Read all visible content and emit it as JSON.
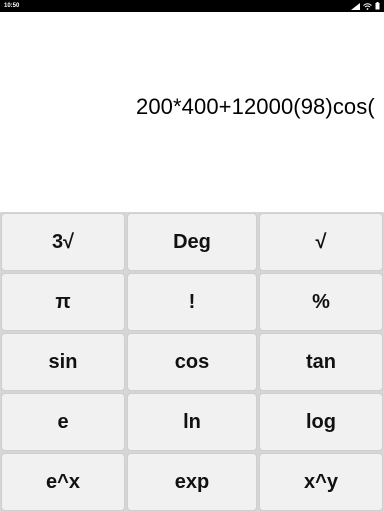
{
  "status_bar": {
    "time": "10:50",
    "icons": [
      "signal-icon",
      "wifi-icon",
      "battery-icon"
    ]
  },
  "display": {
    "expression": "200*400+12000(98)cos("
  },
  "keypad": {
    "rows": [
      [
        "3√",
        "Deg",
        "√"
      ],
      [
        "π",
        "!",
        "%"
      ],
      [
        "sin",
        "cos",
        "tan"
      ],
      [
        "e",
        "ln",
        "log"
      ],
      [
        "e^x",
        "exp",
        "x^y"
      ]
    ]
  }
}
